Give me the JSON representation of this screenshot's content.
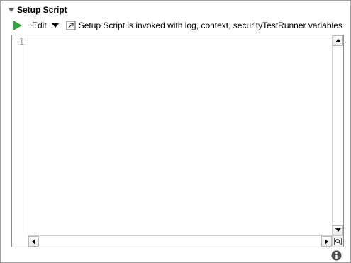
{
  "section": {
    "title": "Setup Script"
  },
  "toolbar": {
    "run_icon": "play-icon",
    "edit_label": "Edit",
    "hint_icon": "script-link-icon",
    "hint_text": "Setup Script is invoked with log, context, securityTestRunner variables"
  },
  "editor": {
    "line_numbers": [
      "1"
    ],
    "content": ""
  },
  "footer": {
    "info_icon": "info-icon"
  },
  "colors": {
    "run_green": "#2eaa3a",
    "info_blue": "#4a4a4a"
  }
}
